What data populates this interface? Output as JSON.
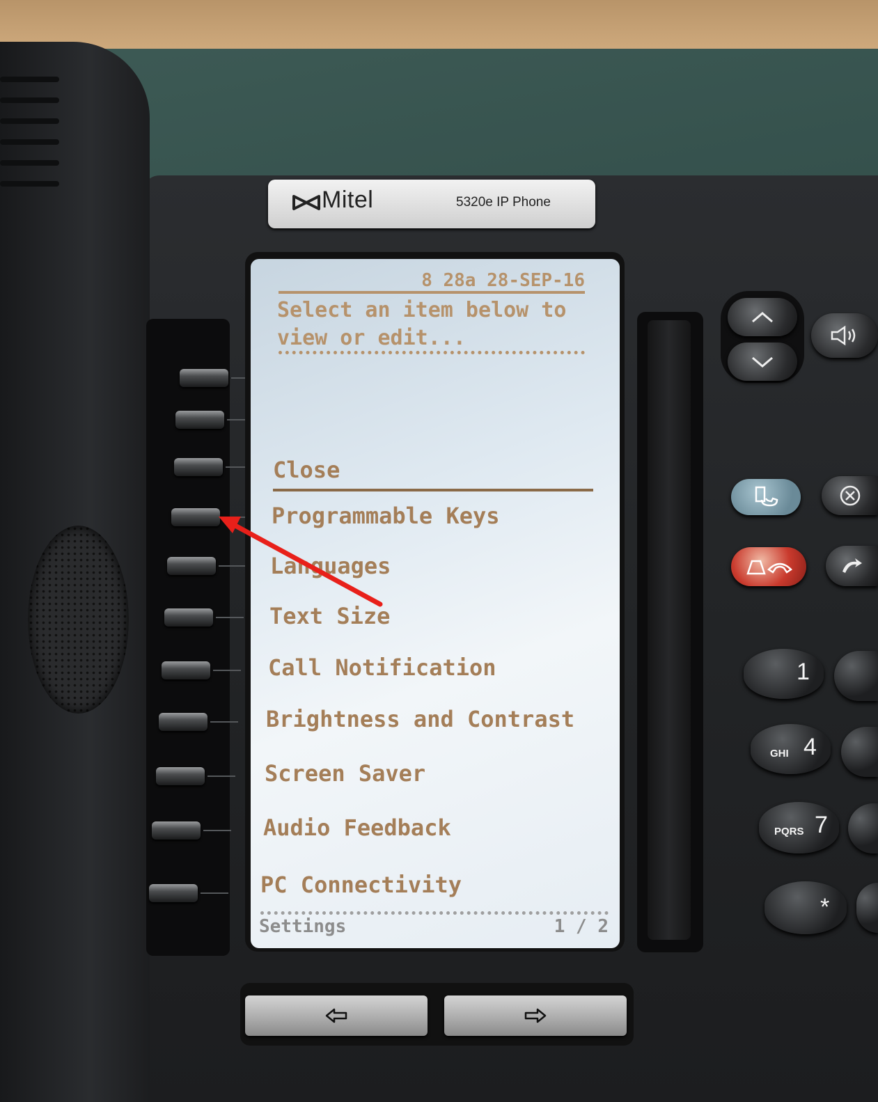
{
  "brand": {
    "name": "Mitel",
    "model": "5320e IP Phone",
    "logo_icon": "mitel-logo-icon"
  },
  "screen": {
    "datetime": "8 28a 28-SEP-16",
    "prompt": "Select an item below to\nview or edit...",
    "close_label": "Close",
    "menu_items": [
      "Programmable Keys",
      "Languages",
      "Text Size",
      "Call Notification",
      "Brightness and Contrast",
      "Screen Saver",
      "Audio Feedback",
      "PC Connectivity"
    ],
    "footer_title": "Settings",
    "footer_page": "1 / 2",
    "text_color": "#b6926b"
  },
  "dialpad": [
    {
      "digit": "1",
      "letters": ""
    },
    {
      "digit": "4",
      "letters": "GHI"
    },
    {
      "digit": "7",
      "letters": "PQRS"
    },
    {
      "digit": "*",
      "letters": ""
    }
  ],
  "annotation": {
    "color": "#e8201a",
    "icon": "red-arrow-icon"
  },
  "icons": {
    "up": "chevron-up-icon",
    "down": "chevron-down-icon",
    "speaker": "speaker-icon",
    "transfer": "transfer-icon",
    "cancel": "cancel-icon",
    "hold": "hold-icon",
    "redial": "redial-icon",
    "left": "arrow-left-icon",
    "right": "arrow-right-icon"
  }
}
